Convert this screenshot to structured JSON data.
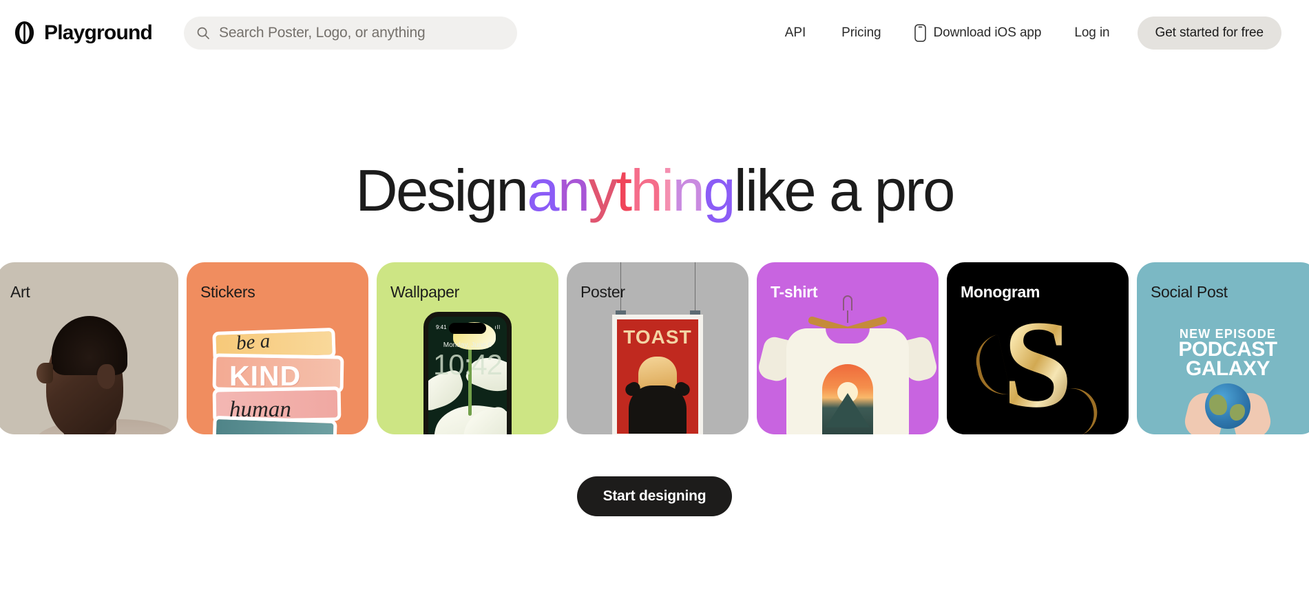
{
  "header": {
    "brand": "Playground",
    "logo_icon": "playground-circle-bar-logo",
    "search": {
      "icon": "search-icon",
      "placeholder": "Search Poster, Logo, or anything"
    },
    "nav": [
      {
        "label": "API"
      },
      {
        "label": "Pricing"
      }
    ],
    "ios": {
      "icon": "phone-icon",
      "label": "Download iOS app"
    },
    "login_label": "Log in",
    "cta_label": "Get started for free"
  },
  "hero": {
    "headline_parts": [
      {
        "text": "Design",
        "color": "#1c1c1c"
      },
      {
        "text": "a",
        "color": "#8b5cf6"
      },
      {
        "text": "n",
        "color": "#a855d6"
      },
      {
        "text": "y",
        "color": "#e05570"
      },
      {
        "text": "t",
        "color": "#f0455a"
      },
      {
        "text": "h",
        "color": "#f56d8a"
      },
      {
        "text": "i",
        "color": "#f48fb0"
      },
      {
        "text": "n",
        "color": "#c98ae0"
      },
      {
        "text": "g",
        "color": "#8b5cf6"
      },
      {
        "text": "like a pro",
        "color": "#1c1c1c"
      }
    ],
    "start_label": "Start designing"
  },
  "cards": [
    {
      "label": "Art",
      "bg": "#c8c0b3",
      "label_style": "dark",
      "media": "portrait-photo"
    },
    {
      "label": "Stickers",
      "bg": "#f08d5f",
      "label_style": "dark",
      "media": "sticker-sheet",
      "art_text": {
        "line1": "be a",
        "line2": "KIND",
        "line3": "human"
      }
    },
    {
      "label": "Wallpaper",
      "bg": "#cde584",
      "label_style": "dark",
      "media": "phone-lockscreen",
      "art_text": {
        "status_time": "9:41",
        "date": "Monday, June 6",
        "clock": "10:42",
        "signal": "ıll"
      }
    },
    {
      "label": "Poster",
      "bg": "#b4b4b4",
      "label_style": "dark",
      "media": "hanging-poster",
      "art_text": {
        "title": "TOAST"
      }
    },
    {
      "label": "T-shirt",
      "bg": "#c864e0",
      "label_style": "light",
      "media": "tshirt-on-hanger"
    },
    {
      "label": "Monogram",
      "bg": "#000000",
      "label_style": "light-bold",
      "media": "gold-letter",
      "art_text": {
        "letter": "S"
      }
    },
    {
      "label": "Social Post",
      "bg": "#7bb8c4",
      "label_style": "dark",
      "media": "podcast-cover",
      "art_text": {
        "line1": "NEW EPISODE",
        "line2": "PODCAST",
        "line3": "GALAXY"
      }
    }
  ]
}
